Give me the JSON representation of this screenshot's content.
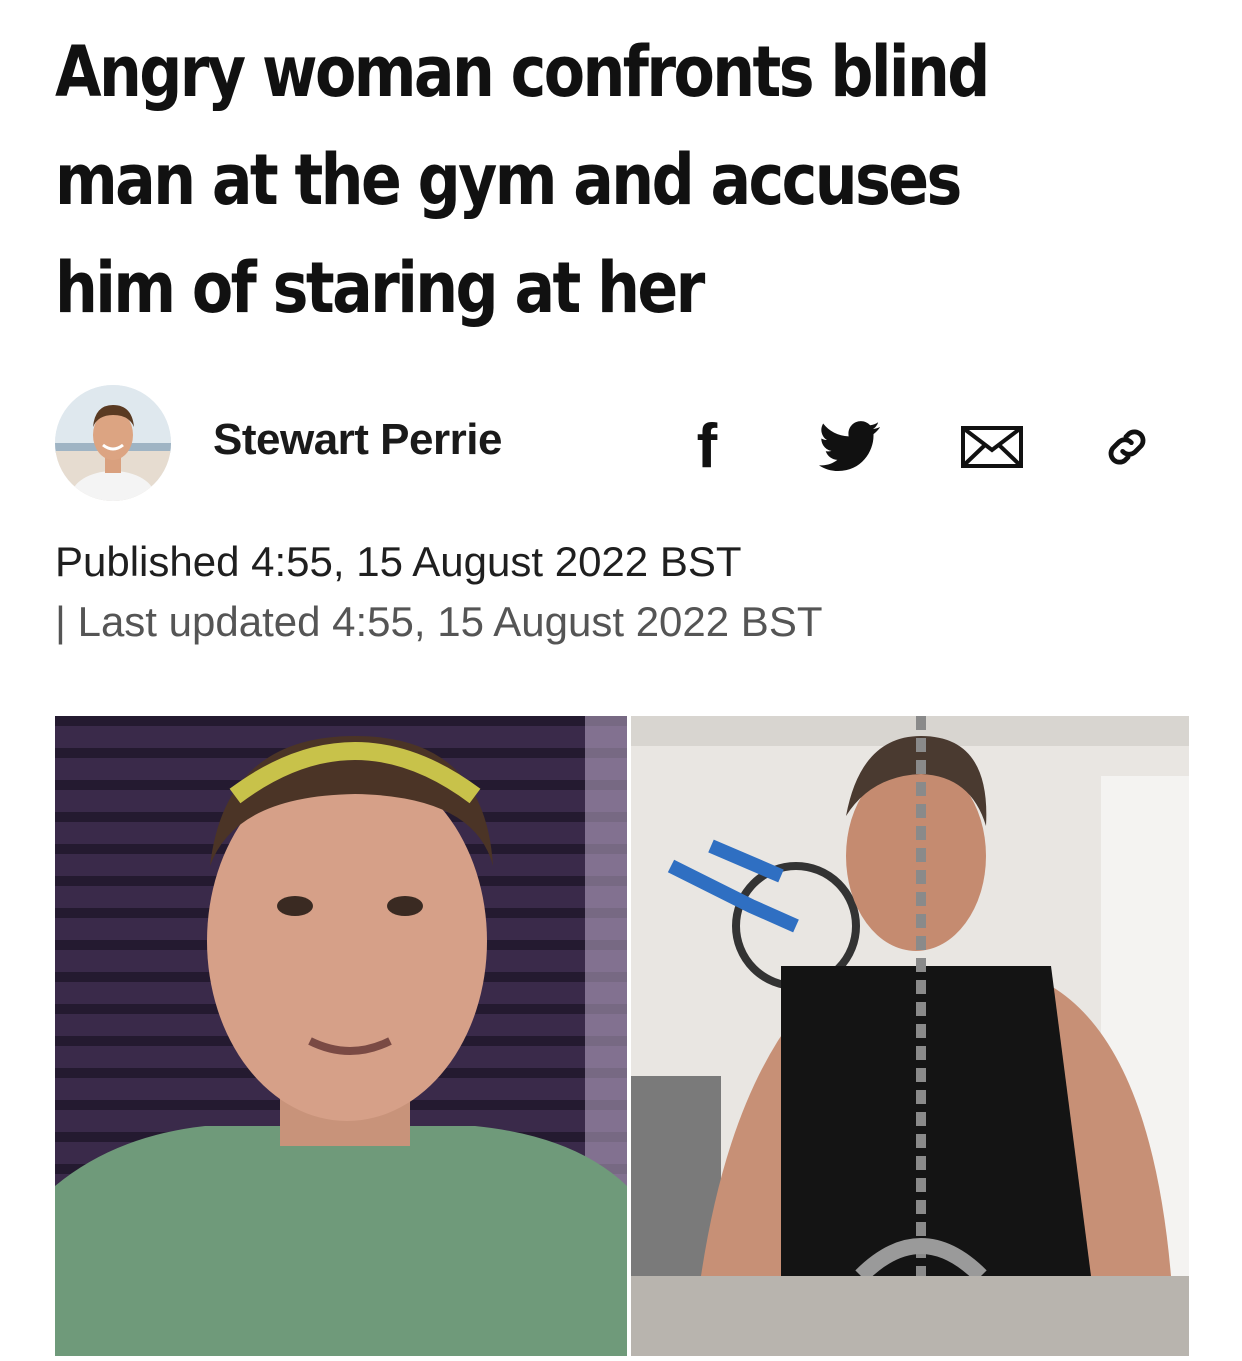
{
  "article": {
    "headline": "Angry woman confronts blind man at the gym and accuses him of staring at her",
    "author": "Stewart Perrie",
    "published": "Published 4:55, 15 August 2022 BST",
    "updated": "| Last updated 4:55, 15 August 2022 BST"
  },
  "share": {
    "facebook_icon": "f"
  },
  "icons": [
    "facebook-icon",
    "twitter-icon",
    "email-icon",
    "link-icon"
  ],
  "colors": {
    "text": "#111111",
    "muted": "#555555",
    "background": "#ffffff"
  }
}
